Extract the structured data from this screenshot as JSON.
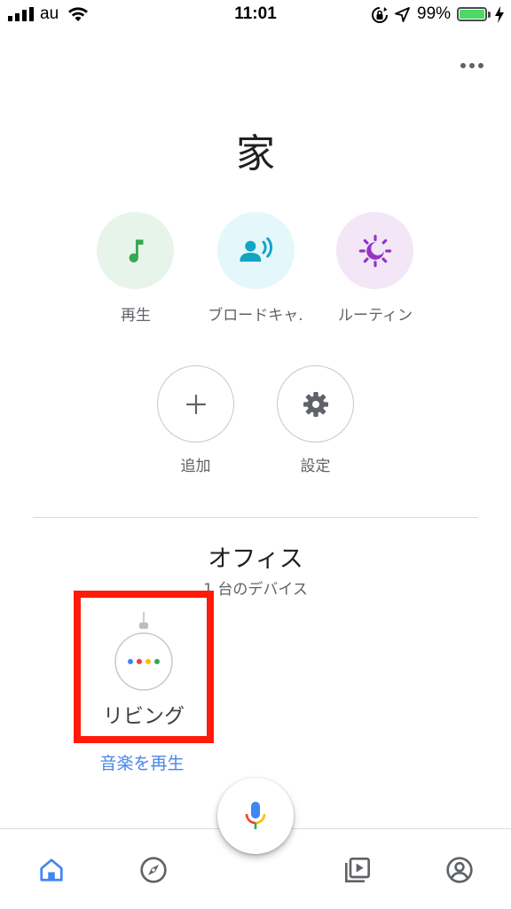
{
  "status_bar": {
    "carrier": "au",
    "time": "11:01",
    "battery_percent": "99%",
    "battery_level": 0.99
  },
  "header": {
    "menu_icon": "more-horizontal-icon",
    "title": "家"
  },
  "actions": [
    {
      "label": "再生",
      "icon": "music-note-icon",
      "bg": "#e6f4ea",
      "fg": "#34a853"
    },
    {
      "label": "ブロードキャ.",
      "icon": "broadcast-icon",
      "bg": "#e4f7fb",
      "fg": "#12a4c4"
    },
    {
      "label": "ルーティン",
      "icon": "routine-icon",
      "bg": "#f3e6f7",
      "fg": "#9334c6"
    }
  ],
  "secondary_actions": [
    {
      "label": "追加",
      "icon": "plus-icon"
    },
    {
      "label": "設定",
      "icon": "gear-icon"
    }
  ],
  "room": {
    "name": "オフィス",
    "device_count": "1 台のデバイス",
    "device": {
      "name": "リビング",
      "icon": "google-home-mini-icon",
      "dot_colors": [
        "#4285f4",
        "#ea4335",
        "#fbbc05",
        "#34a853"
      ]
    },
    "play_link": "音楽を再生"
  },
  "highlight_color": "#ff1a0a",
  "bottom_nav": {
    "items": [
      "home-icon",
      "explore-icon",
      "mic-icon",
      "media-icon",
      "account-icon"
    ],
    "active_color": "#4285f4"
  }
}
